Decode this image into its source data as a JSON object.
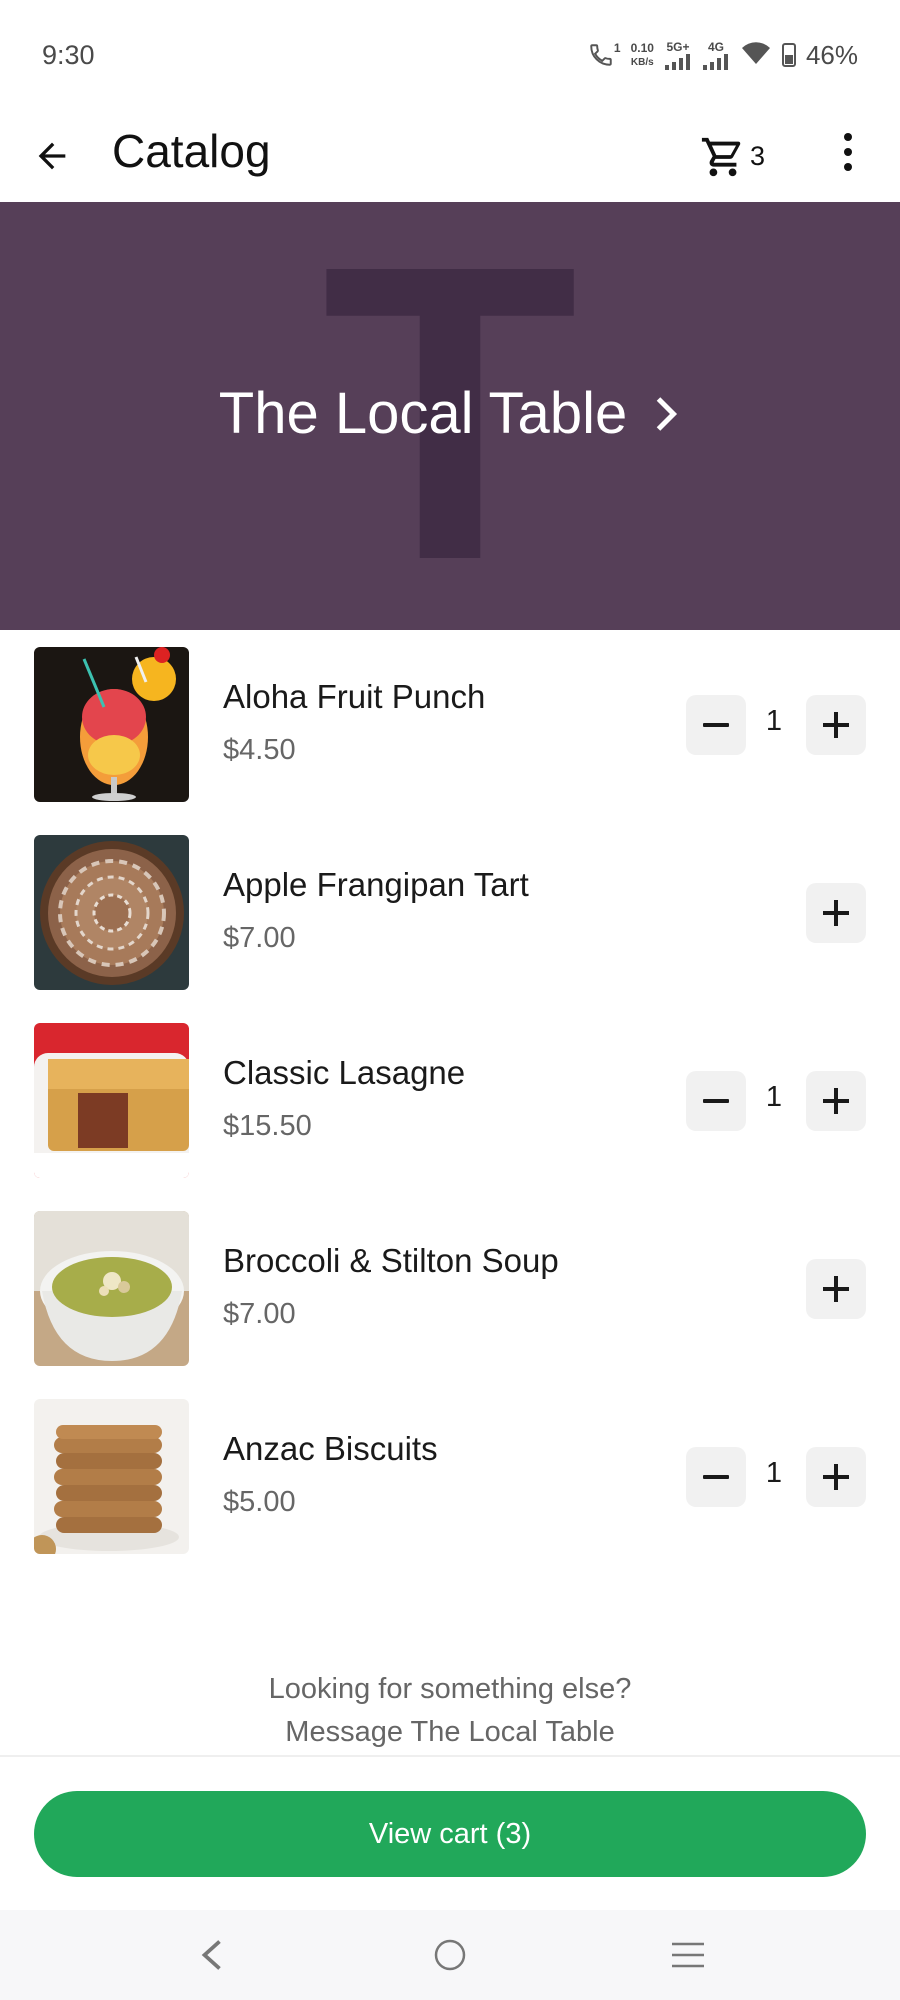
{
  "status_bar": {
    "time": "9:30",
    "net_speed_value": "0.10",
    "net_speed_unit": "KB/s",
    "signal1_label": "5G+",
    "signal2_label": "4G",
    "call_label": "1",
    "battery": "46%"
  },
  "app_bar": {
    "title": "Catalog",
    "cart_count": "3"
  },
  "banner": {
    "letter": "T",
    "title": "The Local Table",
    "background": "#563f58"
  },
  "items": [
    {
      "name": "Aloha Fruit Punch",
      "price": "$4.50",
      "qty": "1"
    },
    {
      "name": "Apple Frangipan Tart",
      "price": "$7.00",
      "qty": ""
    },
    {
      "name": "Classic Lasagne",
      "price": "$15.50",
      "qty": "1"
    },
    {
      "name": "Broccoli & Stilton Soup",
      "price": "$7.00",
      "qty": ""
    },
    {
      "name": "Anzac Biscuits",
      "price": "$5.00",
      "qty": "1"
    }
  ],
  "footer": {
    "line1": "Looking for something else?",
    "line2": "Message The Local Table"
  },
  "view_cart": {
    "label": "View cart (3)",
    "color": "#21a85a"
  },
  "icons": {
    "back": "arrow-left-icon",
    "cart": "cart-icon",
    "more": "more-vert-icon",
    "nav_back": "chevron-left-icon",
    "nav_home": "circle-icon",
    "nav_menu": "menu-icon"
  }
}
